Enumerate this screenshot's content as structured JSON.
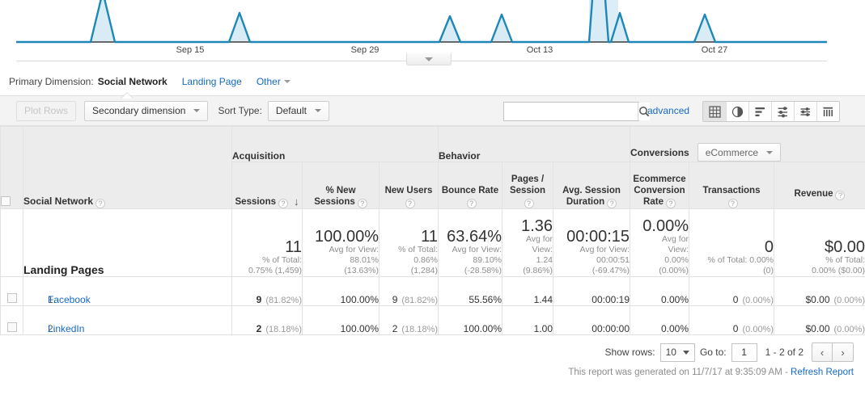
{
  "chart": {
    "tick_labels": [
      "Sep 15",
      "Sep 29",
      "Oct 13",
      "Oct 27"
    ],
    "line_color": "#1d87b8",
    "fill_color": "#d9ecf5"
  },
  "primary_dimension": {
    "label": "Primary Dimension:",
    "active": "Social Network",
    "link": "Landing Page",
    "other": "Other"
  },
  "toolbar": {
    "plot_rows": "Plot Rows",
    "secondary_dimension": "Secondary dimension",
    "sort_type_label": "Sort Type:",
    "sort_type_value": "Default",
    "search_value": "",
    "search_placeholder": "",
    "advanced": "advanced",
    "view_icons": [
      {
        "name": "table-view-icon",
        "selected": true
      },
      {
        "name": "pie-chart-view-icon",
        "selected": false
      },
      {
        "name": "bar-chart-view-icon",
        "selected": false
      },
      {
        "name": "performance-view-icon",
        "selected": false
      },
      {
        "name": "comparison-view-icon",
        "selected": false
      },
      {
        "name": "pivot-view-icon",
        "selected": false
      }
    ]
  },
  "table": {
    "dimension_header": "Social Network",
    "groups": [
      {
        "label": "Acquisition"
      },
      {
        "label": "Behavior"
      },
      {
        "label": "Conversions",
        "dropdown": "eCommerce"
      }
    ],
    "columns": [
      {
        "label": "Sessions",
        "sorted": true,
        "sort_dir": "desc"
      },
      {
        "label": "% New\nSessions"
      },
      {
        "label": "New Users"
      },
      {
        "label": "Bounce Rate"
      },
      {
        "label": "Pages /\nSession"
      },
      {
        "label": "Avg. Session\nDuration"
      },
      {
        "label": "Ecommerce\nConversion\nRate"
      },
      {
        "label": "Transactions"
      },
      {
        "label": "Revenue"
      }
    ],
    "summary": {
      "label": "Landing Pages",
      "cells": [
        {
          "value": "11",
          "sub": "% of Total:\n0.75% (1,459)"
        },
        {
          "value": "100.00%",
          "sub": "Avg for View:\n88.01%\n(13.63%)"
        },
        {
          "value": "11",
          "sub": "% of Total:\n0.86%\n(1,284)"
        },
        {
          "value": "63.64%",
          "sub": "Avg for View:\n89.10%\n(-28.58%)"
        },
        {
          "value": "1.36",
          "sub": "Avg for\nView:\n1.24\n(9.86%)"
        },
        {
          "value": "00:00:15",
          "sub": "Avg for View:\n00:00:51\n(-69.47%)"
        },
        {
          "value": "0.00%",
          "sub": "Avg for\nView:\n0.00%\n(0.00%)"
        },
        {
          "value": "0",
          "sub": "% of Total: 0.00%\n(0)"
        },
        {
          "value": "$0.00",
          "sub": "% of Total:\n0.00% ($0.00)"
        }
      ]
    },
    "rows": [
      {
        "index": "1.",
        "name": "Facebook",
        "sessions": "9",
        "sessions_pct": "(81.82%)",
        "new_sessions": "100.00%",
        "new_users": "9",
        "new_users_pct": "(81.82%)",
        "bounce_rate": "55.56%",
        "pages_session": "1.44",
        "avg_duration": "00:00:19",
        "ecom_rate": "0.00%",
        "transactions": "0",
        "transactions_pct": "(0.00%)",
        "revenue": "$0.00",
        "revenue_pct": "(0.00%)"
      },
      {
        "index": "2.",
        "name": "LinkedIn",
        "sessions": "2",
        "sessions_pct": "(18.18%)",
        "new_sessions": "100.00%",
        "new_users": "2",
        "new_users_pct": "(18.18%)",
        "bounce_rate": "100.00%",
        "pages_session": "1.00",
        "avg_duration": "00:00:00",
        "ecom_rate": "0.00%",
        "transactions": "0",
        "transactions_pct": "(0.00%)",
        "revenue": "$0.00",
        "revenue_pct": "(0.00%)"
      }
    ]
  },
  "footer": {
    "show_rows_label": "Show rows:",
    "show_rows_value": "10",
    "goto_label": "Go to:",
    "goto_value": "1",
    "range": "1 - 2 of 2",
    "prev": "‹",
    "next": "›",
    "generated_text": "This report was generated on 11/7/17 at 9:35:09 AM - ",
    "refresh": "Refresh Report"
  }
}
